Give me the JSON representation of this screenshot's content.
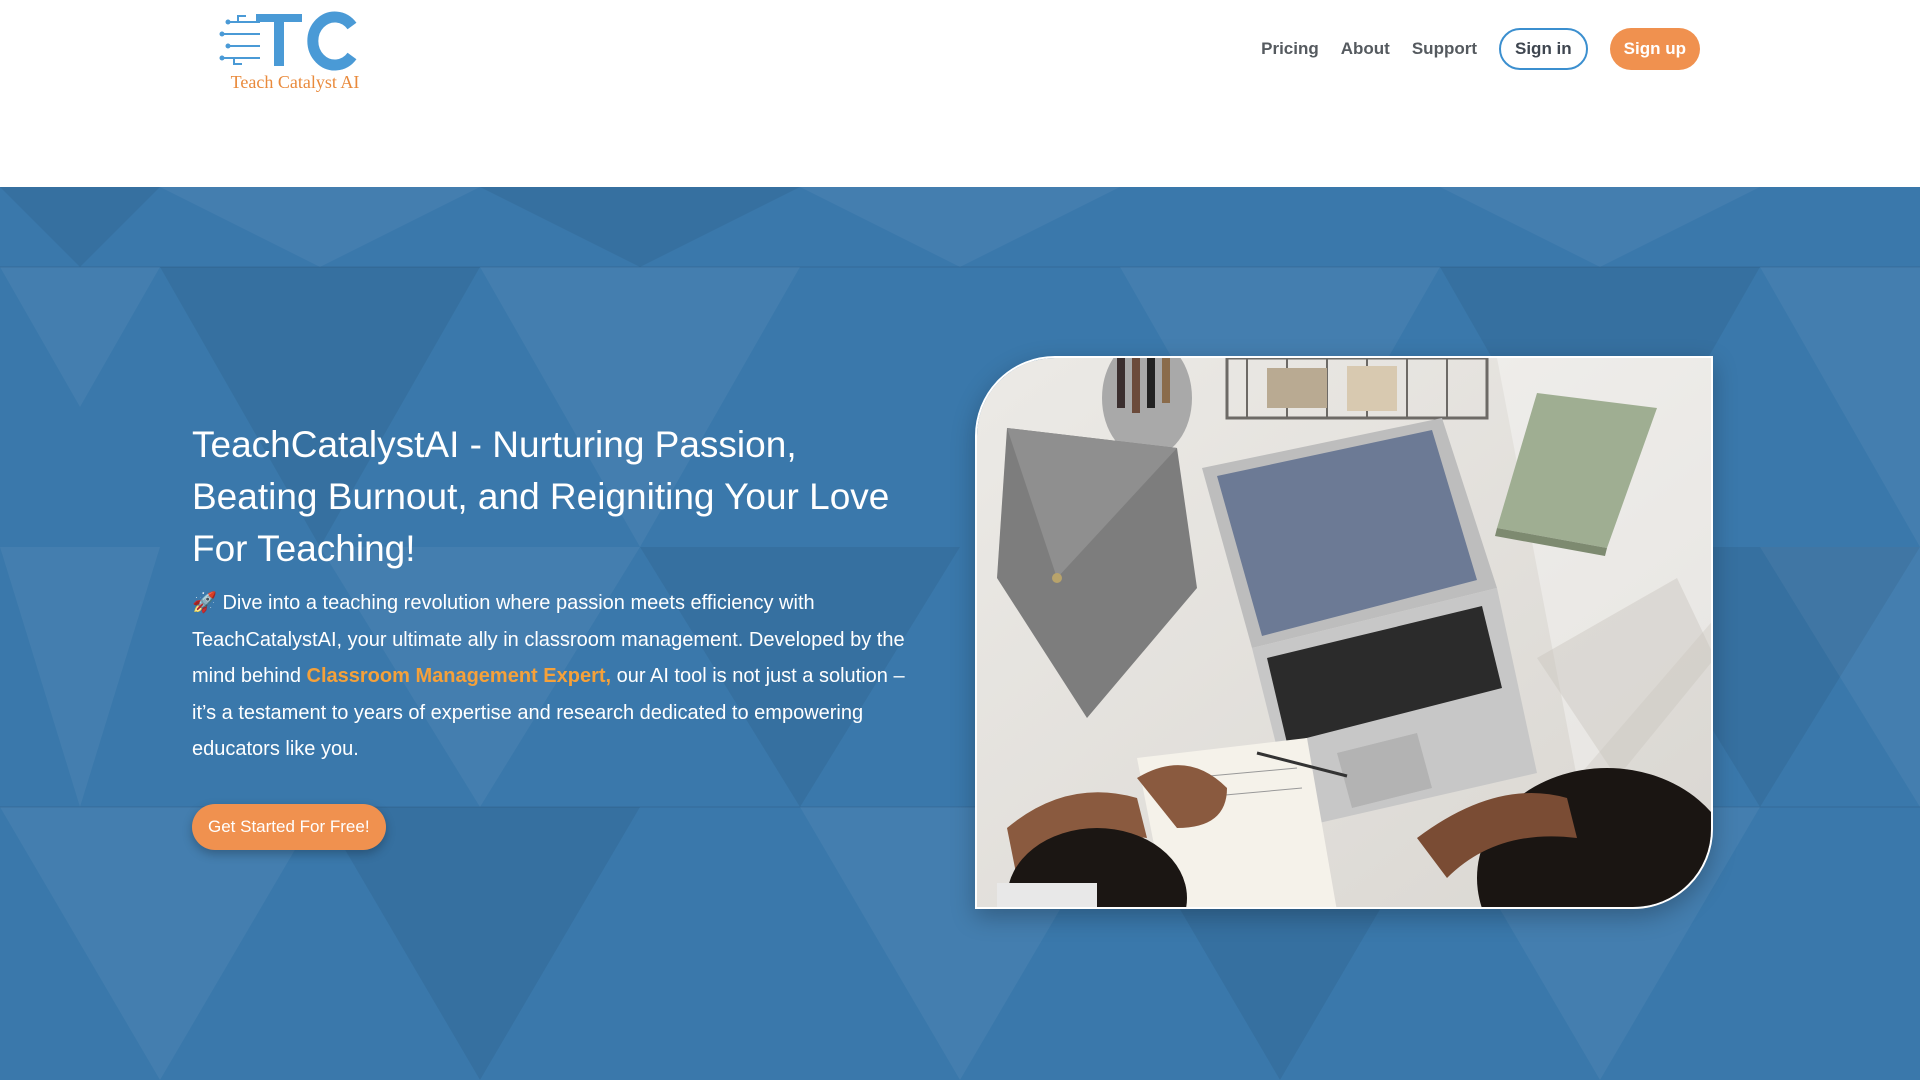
{
  "brand": {
    "logo_letters": "TC",
    "name": "Teach Catalyst AI",
    "accent": "#f0914f",
    "blue": "#3b8fcf",
    "hero_bg": "#3a78ab"
  },
  "nav": {
    "items": [
      {
        "label": "Pricing"
      },
      {
        "label": "About"
      },
      {
        "label": "Support"
      }
    ],
    "signin_label": "Sign in",
    "signup_label": "Sign up"
  },
  "hero": {
    "title": "TeachCatalystAI - Nurturing Passion, Beating Burnout, and Reigniting Your Love For Teaching!",
    "body_prefix": "🚀 Dive into a teaching revolution where passion meets efficiency with TeachCatalystAI, your ultimate ally in classroom management. Developed by the mind behind ",
    "body_highlight": "Classroom Management Expert,",
    "body_suffix": " our AI tool is not just a solution – it’s a testament to years of expertise and research dedicated to empowering educators like you.",
    "cta_label": "Get Started For Free!",
    "image_icon": "photo-desk-laptop-students"
  }
}
